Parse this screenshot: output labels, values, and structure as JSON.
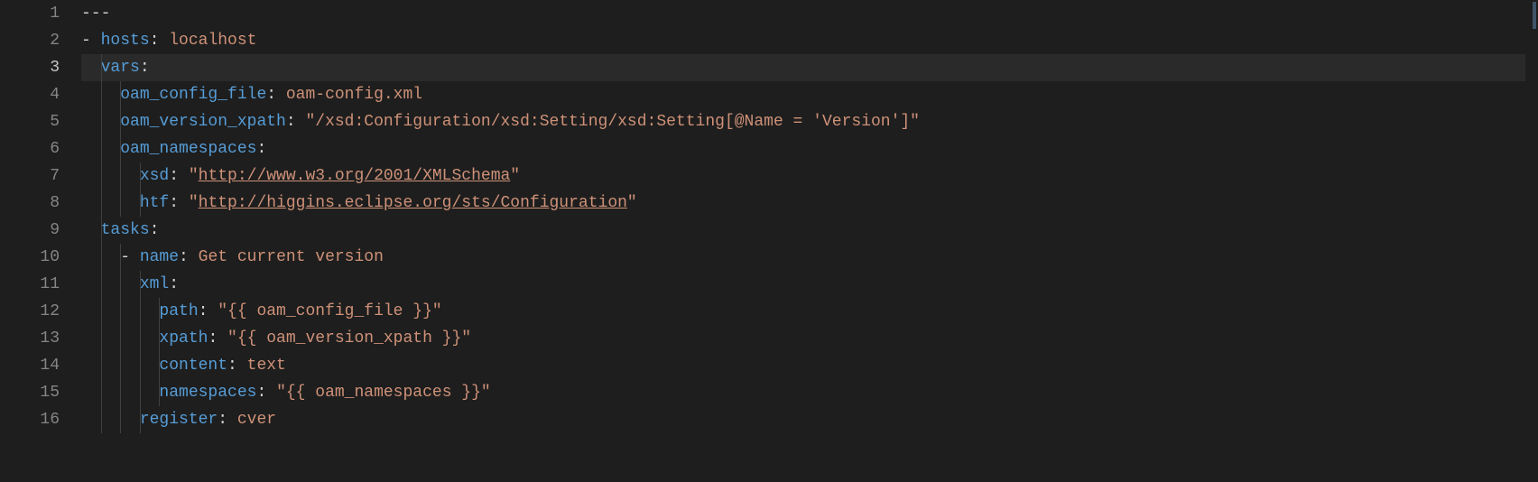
{
  "editor": {
    "active_line": 3,
    "lines": [
      {
        "num": 1,
        "guides": [],
        "tokens": [
          [
            "dash",
            "---"
          ]
        ]
      },
      {
        "num": 2,
        "guides": [],
        "tokens": [
          [
            "dash",
            "- "
          ],
          [
            "key",
            "hosts"
          ],
          [
            "colon",
            ": "
          ],
          [
            "plain",
            "localhost"
          ]
        ]
      },
      {
        "num": 3,
        "guides": [
          2
        ],
        "tokens": [
          [
            "sp",
            "  "
          ],
          [
            "key",
            "vars"
          ],
          [
            "colon",
            ":"
          ]
        ]
      },
      {
        "num": 4,
        "guides": [
          2,
          4
        ],
        "tokens": [
          [
            "sp",
            "    "
          ],
          [
            "key",
            "oam_config_file"
          ],
          [
            "colon",
            ": "
          ],
          [
            "plain",
            "oam-config.xml"
          ]
        ]
      },
      {
        "num": 5,
        "guides": [
          2,
          4
        ],
        "tokens": [
          [
            "sp",
            "    "
          ],
          [
            "key",
            "oam_version_xpath"
          ],
          [
            "colon",
            ": "
          ],
          [
            "str",
            "\"/xsd:Configuration/xsd:Setting/xsd:Setting[@Name = 'Version']\""
          ]
        ]
      },
      {
        "num": 6,
        "guides": [
          2,
          4
        ],
        "tokens": [
          [
            "sp",
            "    "
          ],
          [
            "key",
            "oam_namespaces"
          ],
          [
            "colon",
            ":"
          ]
        ]
      },
      {
        "num": 7,
        "guides": [
          2,
          4,
          6
        ],
        "tokens": [
          [
            "sp",
            "      "
          ],
          [
            "key",
            "xsd"
          ],
          [
            "colon",
            ": "
          ],
          [
            "str",
            "\""
          ],
          [
            "link",
            "http://www.w3.org/2001/XMLSchema"
          ],
          [
            "str",
            "\""
          ]
        ]
      },
      {
        "num": 8,
        "guides": [
          2,
          4,
          6
        ],
        "tokens": [
          [
            "sp",
            "      "
          ],
          [
            "key",
            "htf"
          ],
          [
            "colon",
            ": "
          ],
          [
            "str",
            "\""
          ],
          [
            "link",
            "http://higgins.eclipse.org/sts/Configuration"
          ],
          [
            "str",
            "\""
          ]
        ]
      },
      {
        "num": 9,
        "guides": [
          2
        ],
        "tokens": [
          [
            "sp",
            "  "
          ],
          [
            "key",
            "tasks"
          ],
          [
            "colon",
            ":"
          ]
        ]
      },
      {
        "num": 10,
        "guides": [
          2,
          4
        ],
        "tokens": [
          [
            "sp",
            "    "
          ],
          [
            "dash",
            "- "
          ],
          [
            "key",
            "name"
          ],
          [
            "colon",
            ": "
          ],
          [
            "plain",
            "Get current version"
          ]
        ]
      },
      {
        "num": 11,
        "guides": [
          2,
          4,
          6
        ],
        "tokens": [
          [
            "sp",
            "      "
          ],
          [
            "key",
            "xml"
          ],
          [
            "colon",
            ":"
          ]
        ]
      },
      {
        "num": 12,
        "guides": [
          2,
          4,
          6,
          8
        ],
        "tokens": [
          [
            "sp",
            "        "
          ],
          [
            "key",
            "path"
          ],
          [
            "colon",
            ": "
          ],
          [
            "str",
            "\"{{ oam_config_file }}\""
          ]
        ]
      },
      {
        "num": 13,
        "guides": [
          2,
          4,
          6,
          8
        ],
        "tokens": [
          [
            "sp",
            "        "
          ],
          [
            "key",
            "xpath"
          ],
          [
            "colon",
            ": "
          ],
          [
            "str",
            "\"{{ oam_version_xpath }}\""
          ]
        ]
      },
      {
        "num": 14,
        "guides": [
          2,
          4,
          6,
          8
        ],
        "tokens": [
          [
            "sp",
            "        "
          ],
          [
            "key",
            "content"
          ],
          [
            "colon",
            ": "
          ],
          [
            "plain",
            "text"
          ]
        ]
      },
      {
        "num": 15,
        "guides": [
          2,
          4,
          6,
          8
        ],
        "tokens": [
          [
            "sp",
            "        "
          ],
          [
            "key",
            "namespaces"
          ],
          [
            "colon",
            ": "
          ],
          [
            "str",
            "\"{{ oam_namespaces }}\""
          ]
        ]
      },
      {
        "num": 16,
        "guides": [
          2,
          4,
          6
        ],
        "tokens": [
          [
            "sp",
            "      "
          ],
          [
            "key",
            "register"
          ],
          [
            "colon",
            ": "
          ],
          [
            "plain",
            "cver"
          ]
        ]
      }
    ]
  },
  "yaml_doc": {
    "hosts": "localhost",
    "vars": {
      "oam_config_file": "oam-config.xml",
      "oam_version_xpath": "/xsd:Configuration/xsd:Setting/xsd:Setting[@Name = 'Version']",
      "oam_namespaces": {
        "xsd": "http://www.w3.org/2001/XMLSchema",
        "htf": "http://higgins.eclipse.org/sts/Configuration"
      }
    },
    "tasks": [
      {
        "name": "Get current version",
        "xml": {
          "path": "{{ oam_config_file }}",
          "xpath": "{{ oam_version_xpath }}",
          "content": "text",
          "namespaces": "{{ oam_namespaces }}"
        },
        "register": "cver"
      }
    ]
  },
  "colors": {
    "background": "#1e1e1e",
    "gutter": "#858585",
    "gutter_active": "#c6c6c6",
    "key": "#569cd6",
    "string": "#ce9178",
    "guide": "#404040",
    "active_line_bg": "#2a2a2a"
  }
}
